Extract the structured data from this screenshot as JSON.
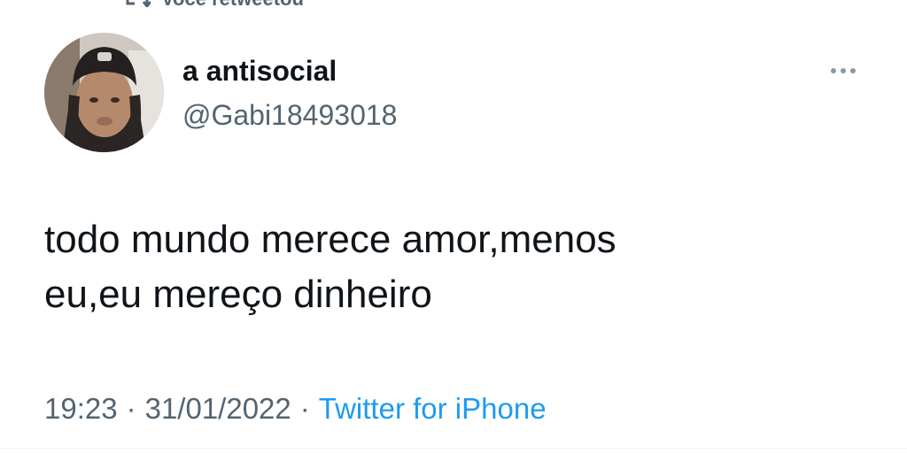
{
  "retweet_banner": {
    "icon": "retweet-icon",
    "text": "Você retweetou"
  },
  "author": {
    "avatar": "profile-photo",
    "display_name": "a antisocial",
    "handle": "@Gabi18493018"
  },
  "more_button": {
    "icon": "ellipsis-icon"
  },
  "tweet": {
    "lines": [
      "todo mundo merece amor,menos",
      "eu,eu mereço dinheiro"
    ]
  },
  "meta": {
    "time": "19:23",
    "separator": "·",
    "date": "31/01/2022",
    "source": "Twitter for iPhone"
  },
  "colors": {
    "text_primary": "#0f1419",
    "text_secondary": "#536471",
    "link": "#1d9bf0",
    "background": "#ffffff"
  }
}
